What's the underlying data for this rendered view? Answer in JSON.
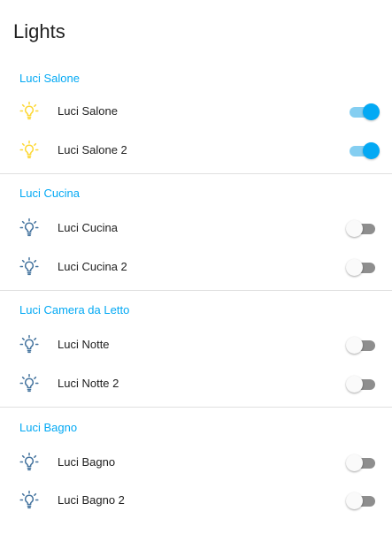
{
  "card": {
    "title": "Lights"
  },
  "colors": {
    "accent": "#03a9f4",
    "bulb_on": "#fdd835",
    "bulb_off": "#44739e",
    "switch_off": "#8e8e8e",
    "divider": "#e0e0e0"
  },
  "groups": [
    {
      "header": "Luci Salone",
      "items": [
        {
          "label": "Luci Salone",
          "icon": "lightbulb-icon",
          "on": true
        },
        {
          "label": "Luci Salone 2",
          "icon": "lightbulb-icon",
          "on": true
        }
      ]
    },
    {
      "header": "Luci Cucina",
      "items": [
        {
          "label": "Luci Cucina",
          "icon": "lightbulb-icon",
          "on": false
        },
        {
          "label": "Luci Cucina 2",
          "icon": "lightbulb-icon",
          "on": false
        }
      ]
    },
    {
      "header": "Luci Camera da Letto",
      "items": [
        {
          "label": "Luci Notte",
          "icon": "lightbulb-icon",
          "on": false
        },
        {
          "label": "Luci Notte 2",
          "icon": "lightbulb-icon",
          "on": false
        }
      ]
    },
    {
      "header": "Luci Bagno",
      "items": [
        {
          "label": "Luci Bagno",
          "icon": "lightbulb-icon",
          "on": false
        },
        {
          "label": "Luci Bagno 2",
          "icon": "lightbulb-icon",
          "on": false
        }
      ]
    }
  ]
}
